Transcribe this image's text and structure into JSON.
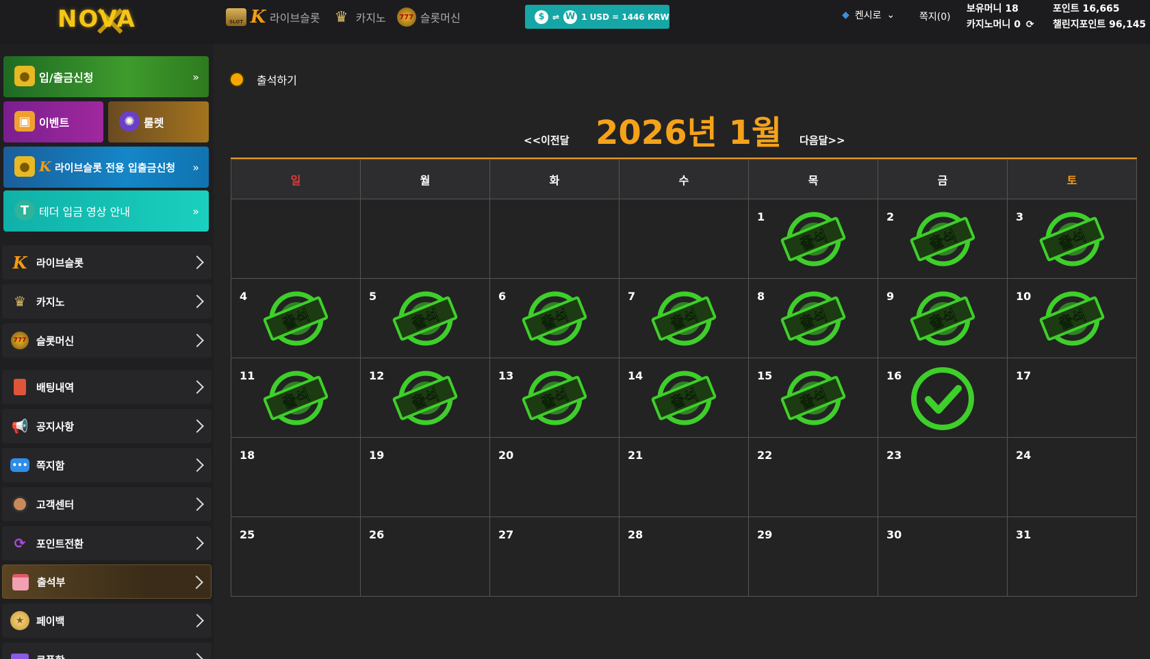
{
  "header": {
    "logo_text": "NOVA",
    "nav": [
      {
        "label": "라이브슬롯",
        "icon": "live-slot-icon"
      },
      {
        "label": "카지노",
        "icon": "casino-icon"
      },
      {
        "label": "슬롯머신",
        "icon": "slot-machine-icon"
      }
    ],
    "slot_badge_text": "SLOT",
    "fx_rate": "1 USD = 1446 KRW",
    "fx_from": "$",
    "fx_to": "W",
    "fx_swap": "⇌",
    "user_name": "켄시로",
    "notes_label": "쪽지(0)",
    "holding_money": "보유머니 18",
    "casino_money": "카지노머니 0",
    "points": "포인트 16,665",
    "challenge_points": "챌린지포인트 96,145"
  },
  "sidebar": {
    "deposit_label": "입/출금신청",
    "event_label": "이벤트",
    "roulette_label": "룰렛",
    "live_deposit_label": "라이브슬롯 전용 입출금신청",
    "tether_label": "테더 입금 영상 안내",
    "double_chevron": "»",
    "menu": [
      {
        "label": "라이브슬롯",
        "icon": "live-slot-icon",
        "active": false
      },
      {
        "label": "카지노",
        "icon": "casino-icon",
        "active": false
      },
      {
        "label": "슬롯머신",
        "icon": "slot-machine-icon",
        "active": false
      },
      {
        "label": "배팅내역",
        "icon": "betting-history-icon",
        "active": false
      },
      {
        "label": "공지사항",
        "icon": "megaphone-icon",
        "active": false
      },
      {
        "label": "쪽지함",
        "icon": "message-icon",
        "active": false
      },
      {
        "label": "고객센터",
        "icon": "support-icon",
        "active": false
      },
      {
        "label": "포인트전환",
        "icon": "point-exchange-icon",
        "active": false
      },
      {
        "label": "출석부",
        "icon": "attendance-icon",
        "active": true
      },
      {
        "label": "페이백",
        "icon": "payback-icon",
        "active": false
      },
      {
        "label": "쿠폰함",
        "icon": "coupon-icon",
        "active": false
      }
    ]
  },
  "main": {
    "section_title": "출석하기",
    "prev_label": "<<이전달",
    "next_label": "다음달>>",
    "month_title": "2026년 1월",
    "weekdays": [
      "일",
      "월",
      "화",
      "수",
      "목",
      "금",
      "토"
    ],
    "stamp_text": "출석",
    "weeks": [
      [
        null,
        null,
        null,
        null,
        {
          "d": "1",
          "s": "stamp"
        },
        {
          "d": "2",
          "s": "stamp"
        },
        {
          "d": "3",
          "s": "stamp"
        }
      ],
      [
        {
          "d": "4",
          "s": "stamp"
        },
        {
          "d": "5",
          "s": "stamp"
        },
        {
          "d": "6",
          "s": "stamp"
        },
        {
          "d": "7",
          "s": "stamp"
        },
        {
          "d": "8",
          "s": "stamp"
        },
        {
          "d": "9",
          "s": "stamp"
        },
        {
          "d": "10",
          "s": "stamp"
        }
      ],
      [
        {
          "d": "11",
          "s": "stamp"
        },
        {
          "d": "12",
          "s": "stamp"
        },
        {
          "d": "13",
          "s": "stamp"
        },
        {
          "d": "14",
          "s": "stamp"
        },
        {
          "d": "15",
          "s": "stamp"
        },
        {
          "d": "16",
          "s": "check"
        },
        {
          "d": "17",
          "s": ""
        }
      ],
      [
        {
          "d": "18",
          "s": ""
        },
        {
          "d": "19",
          "s": ""
        },
        {
          "d": "20",
          "s": ""
        },
        {
          "d": "21",
          "s": ""
        },
        {
          "d": "22",
          "s": ""
        },
        {
          "d": "23",
          "s": ""
        },
        {
          "d": "24",
          "s": ""
        }
      ],
      [
        {
          "d": "25",
          "s": ""
        },
        {
          "d": "26",
          "s": ""
        },
        {
          "d": "27",
          "s": ""
        },
        {
          "d": "28",
          "s": ""
        },
        {
          "d": "29",
          "s": ""
        },
        {
          "d": "30",
          "s": ""
        },
        {
          "d": "31",
          "s": ""
        }
      ]
    ]
  },
  "colors": {
    "accent": "#f5a21a",
    "stamp_green": "#3ecf2a",
    "sunday": "#e53935",
    "saturday": "#f39c12"
  }
}
